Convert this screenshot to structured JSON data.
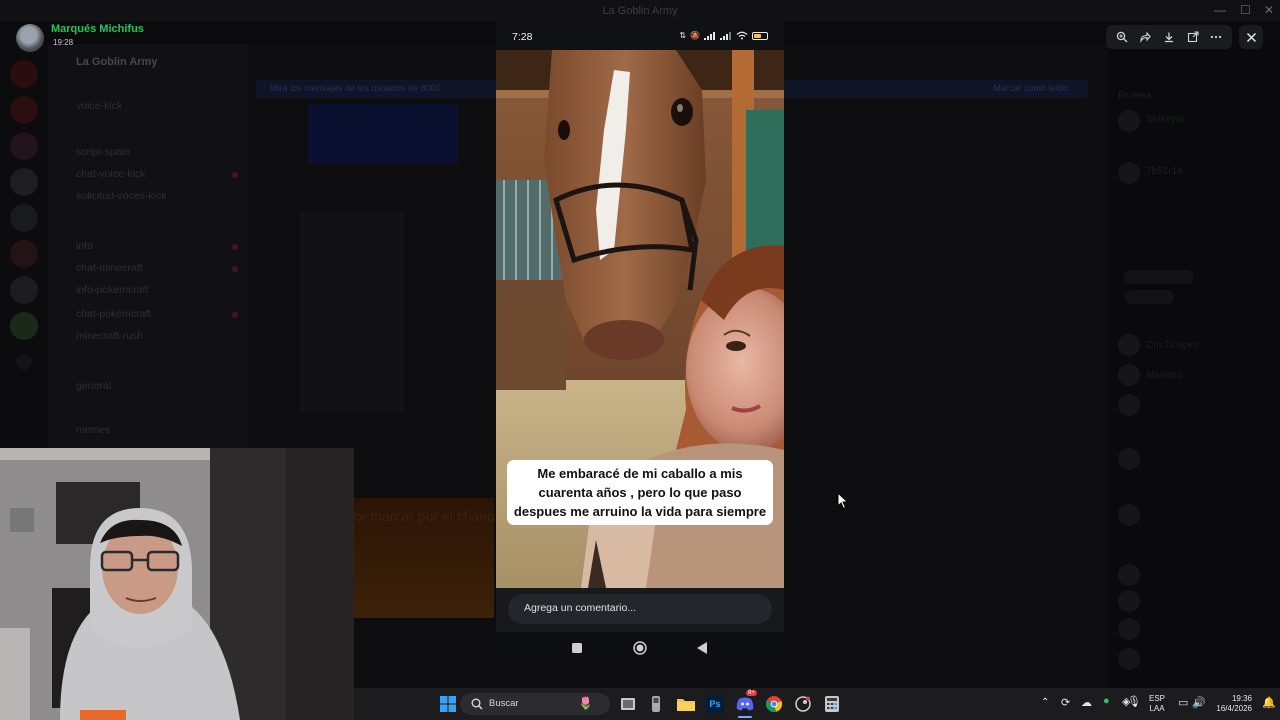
{
  "window": {
    "title": "La Goblin Army"
  },
  "viewer": {
    "author_name": "Marqués Michifus",
    "post_time": "19:28",
    "toolbar": [
      "zoom-icon",
      "forward-icon",
      "download-icon",
      "open-external-icon",
      "more-icon"
    ],
    "close_icon": "close-icon"
  },
  "discord_bg": {
    "server_name": "La Goblin Army",
    "channels": [
      "voice-kick",
      "script-spam",
      "chat-voice-kick",
      "solicitud-voces-kick",
      "info",
      "chat-minecraft",
      "info-pokemcraft",
      "chat-pokemcraft",
      "minecraft-rush",
      "general",
      "memes"
    ],
    "banner": "Mira los mensajes de los usuarios de 8000",
    "banner_action": "Marcar como leído",
    "members_online_label": "En línea",
    "member_names": [
      "Shikeyla",
      "7h51r14",
      "CrisTiLopez",
      "Mariano"
    ],
    "chat_placeholder_partial": "or marcar por el chano"
  },
  "phone": {
    "status_time": "7:28",
    "status_icons": [
      "data-icon",
      "mute-icon",
      "signal-icon",
      "signal2-icon",
      "wifi-icon"
    ],
    "battery_level": 0.6,
    "caption": "Me embaracé de mi caballo a mis cuarenta años , pero lo que paso despues me arruino la vida para siempre",
    "comment_placeholder": "Agrega un comentario...",
    "nav": [
      "recent-apps-icon",
      "home-icon",
      "back-icon"
    ]
  },
  "taskbar": {
    "search_label": "Buscar",
    "apps": [
      "windows-start-icon",
      "search-icon",
      "widgets-icon",
      "task-view-icon",
      "terminal-icon",
      "file-explorer-icon",
      "photoshop-icon",
      "discord-icon",
      "chrome-icon",
      "steam-icon",
      "calculator-icon"
    ],
    "photoshop_label": "Ps",
    "discord_badge": "9+",
    "lang_top": "ESP",
    "lang_bottom": "LAA",
    "clock_time": "19:36",
    "clock_date": "16/4/2026"
  }
}
